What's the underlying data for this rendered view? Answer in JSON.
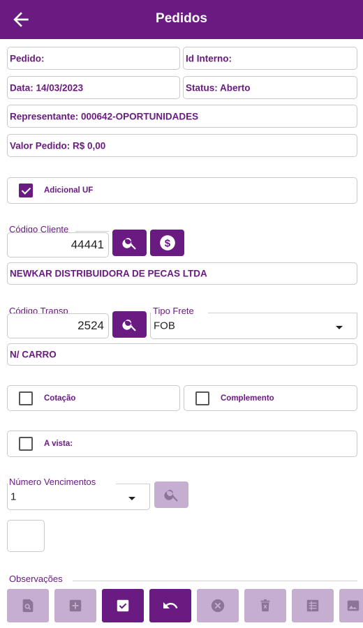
{
  "header": {
    "title": "Pedidos",
    "back_icon": "arrow-back-icon"
  },
  "fields": {
    "pedido": "Pedido:",
    "id_interno": "Id Interno:",
    "data": "Data: 14/03/2023",
    "status": "Status: Aberto",
    "representante": "Representante: 000642-OPORTUNIDADES",
    "valor_pedido": "Valor Pedido: R$ 0,00"
  },
  "adicional_uf": {
    "label": "Adicional UF",
    "checked": true
  },
  "cliente": {
    "label": "Código Cliente",
    "value": "44441",
    "name": "NEWKAR DISTRIBUIDORA DE PECAS LTDA",
    "search_icon": "search-icon",
    "money_icon": "dollar-icon"
  },
  "transp": {
    "label": "Código Transp",
    "value": "2524",
    "name": "N/ CARRO"
  },
  "tipo_frete": {
    "label": "Tipo Frete",
    "selected": "FOB"
  },
  "checks": {
    "cotacao": "Cotação",
    "complemento": "Complemento",
    "a_vista": "A vista:"
  },
  "vencimentos": {
    "label": "Número Vencimentos",
    "selected": "1"
  },
  "observacoes": {
    "label": "Observações"
  },
  "colors": {
    "primary": "#6a1b82",
    "disabled": "#c6aed0"
  }
}
